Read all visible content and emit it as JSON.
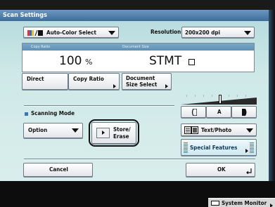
{
  "window": {
    "title": "Scan Settings"
  },
  "color_select": {
    "label": "Auto-Color Select"
  },
  "resolution": {
    "label": "Resolution:",
    "value": "200x200 dpi"
  },
  "display": {
    "copy_ratio_header": "Copy Ratio",
    "doc_size_header": "Document Size",
    "ratio_value": "100",
    "ratio_unit": "%",
    "doc_size_value": "STMT"
  },
  "buttons": {
    "direct": "Direct",
    "copy_ratio": "Copy Ratio",
    "document_size_line1": "Document",
    "document_size_line2": "Size Select",
    "store_erase_line1": "Store/",
    "store_erase_line2": "Erase",
    "cancel": "Cancel",
    "ok": "OK",
    "special_features": "Special Features"
  },
  "scanning_mode": {
    "label": "Scanning Mode",
    "value": "Option"
  },
  "density": {
    "light_label": "",
    "auto_label": "A",
    "dark_label": "",
    "level_fraction": 0.5
  },
  "image_type": {
    "value": "Text/Photo"
  },
  "system_monitor": {
    "label": "System Monitor"
  },
  "colors": {
    "title_bar": "#4f7fab",
    "panel": "#c9e6e6",
    "display_header": "#6a9cc0"
  }
}
